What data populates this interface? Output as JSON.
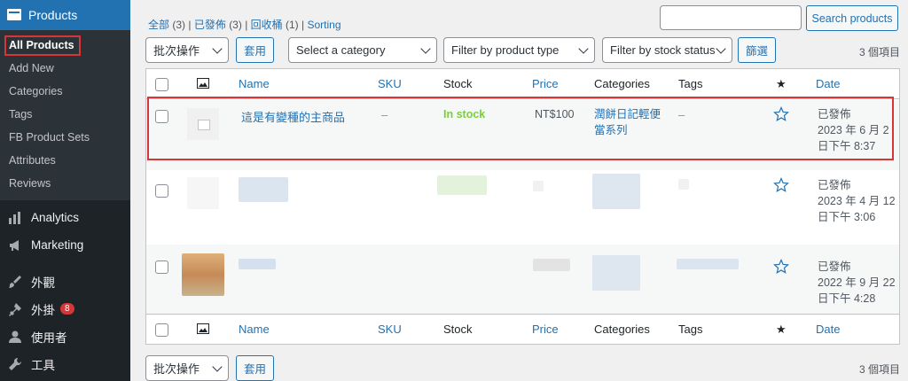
{
  "sidebar": {
    "products_label": "Products",
    "submenu": [
      "All Products",
      "Add New",
      "Categories",
      "Tags",
      "FB Product Sets",
      "Attributes",
      "Reviews"
    ],
    "items": [
      {
        "label": "Analytics",
        "icon": "bar-chart-icon"
      },
      {
        "label": "Marketing",
        "icon": "megaphone-icon"
      },
      {
        "label": "外觀",
        "icon": "paintbrush-icon"
      },
      {
        "label": "外掛",
        "icon": "plugin-icon",
        "badge": "8"
      },
      {
        "label": "使用者",
        "icon": "user-icon"
      },
      {
        "label": "工具",
        "icon": "wrench-icon"
      }
    ]
  },
  "filters": {
    "all": "全部",
    "all_count": "(3)",
    "published": "已發佈",
    "published_count": "(3)",
    "trash": "回收桶",
    "trash_count": "(1)",
    "sorting": "Sorting"
  },
  "search": {
    "button": "Search products",
    "value": ""
  },
  "toolbar": {
    "bulk_action": "批次操作",
    "apply": "套用",
    "category": "Select a category",
    "product_type": "Filter by product type",
    "stock_status": "Filter by stock status",
    "filter": "篩選",
    "count": "3 個項目"
  },
  "columns": [
    "Name",
    "SKU",
    "Stock",
    "Price",
    "Categories",
    "Tags",
    "Date"
  ],
  "rows": [
    {
      "name": "這是有變種的主商品",
      "sku": "–",
      "stock": "In stock",
      "price": "NT$100",
      "categories": "潤餅日記輕便當系列",
      "tags": "–",
      "status": "已發佈",
      "date_line1": "2023 年 6 月 2",
      "date_line2": "日下午 8:37"
    },
    {
      "status": "已發佈",
      "date_line1": "2023 年 4 月 12",
      "date_line2": "日下午 3:06"
    },
    {
      "status": "已發佈",
      "date_line1": "2022 年 9 月 22",
      "date_line2": "日下午 4:28"
    }
  ],
  "colors": {
    "accent": "#2271b1",
    "instock": "#7ad03a",
    "highlight": "#d63638",
    "sidebar": "#1d2327"
  }
}
